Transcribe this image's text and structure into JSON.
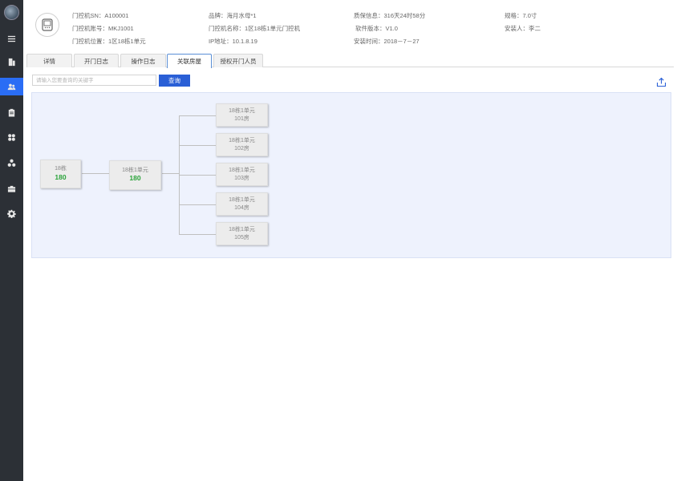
{
  "sidebar": {
    "items": [
      {
        "name": "menu-icon"
      },
      {
        "name": "building-icon"
      },
      {
        "name": "users-icon",
        "active": true
      },
      {
        "name": "clipboard-icon"
      },
      {
        "name": "apps-icon"
      },
      {
        "name": "cluster-icon"
      },
      {
        "name": "briefcase-icon"
      },
      {
        "name": "settings-icon"
      }
    ]
  },
  "device": {
    "sn": "门控机SN：A100001",
    "account": "门控机账号：MKJ1001",
    "location": "门控机位置：1区18栋1单元",
    "brand": "品牌：海月水母*1",
    "name": "门控机名称：1区18栋1单元门控机",
    "ip": "IP地址：10.1.8.19",
    "warranty": "质保信息：316天24时58分",
    "software": "软件版本：V1.0",
    "install_time": "安装时间：2018－7－27",
    "spec": "规格：7.0寸",
    "installer": "安装人：李二"
  },
  "tabs": [
    {
      "label": "详情"
    },
    {
      "label": "开门日志"
    },
    {
      "label": "操作日志"
    },
    {
      "label": "关联房屋",
      "active": true
    },
    {
      "label": "授权开门人员"
    }
  ],
  "search": {
    "placeholder": "请输入您要查询的关键字",
    "value": "",
    "button_label": "查询"
  },
  "tree": {
    "root": {
      "label": "18栋",
      "count": "180"
    },
    "unit": {
      "label": "18栋1单元",
      "count": "180"
    },
    "rooms": [
      {
        "unit": "18栋1单元",
        "room": "101房"
      },
      {
        "unit": "18栋1单元",
        "room": "102房"
      },
      {
        "unit": "18栋1单元",
        "room": "103房"
      },
      {
        "unit": "18栋1单元",
        "room": "104房"
      },
      {
        "unit": "18栋1单元",
        "room": "105房"
      }
    ]
  },
  "colors": {
    "sidebar_bg": "#2c3036",
    "accent": "#2a6df5",
    "count_green": "#2aa33a",
    "tree_bg": "#eef2fd"
  }
}
